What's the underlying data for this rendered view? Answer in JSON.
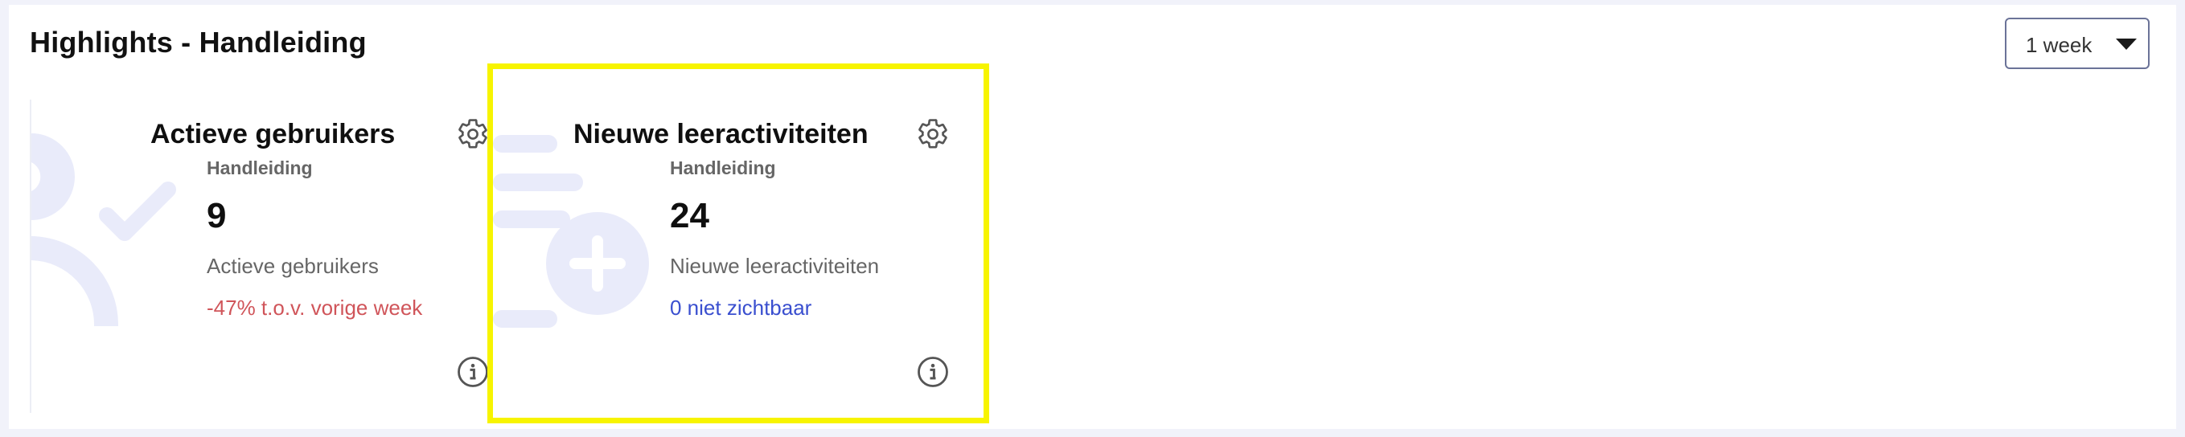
{
  "header": {
    "title": "Highlights - Handleiding",
    "period_select": {
      "value": "1 week"
    }
  },
  "cards": [
    {
      "title": "Actieve gebruikers",
      "subtitle": "Handleiding",
      "value": "9",
      "metric_label": "Actieve gebruikers",
      "note": "-47% t.o.v. vorige week",
      "note_color": "#d0555a"
    },
    {
      "title": "Nieuwe leeractiviteiten",
      "subtitle": "Handleiding",
      "value": "24",
      "metric_label": "Nieuwe leeractiviteiten",
      "note": "0 niet zichtbaar",
      "note_color": "#3a4fcf"
    }
  ],
  "colors": {
    "background": "#f1f2fa",
    "illustration": "#e9ebfa",
    "highlight": "#f7f400",
    "select_border": "#6b7398"
  },
  "icons": [
    "caret-down-icon",
    "gear-icon",
    "info-icon",
    "user-check-illustration",
    "list-add-illustration"
  ]
}
